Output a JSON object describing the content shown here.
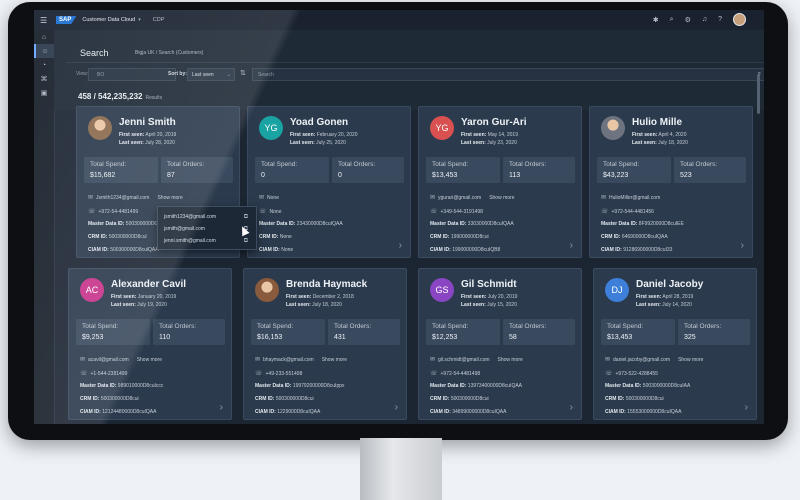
{
  "shell": {
    "logo": "SAP",
    "app_title": "Customer Data Cloud",
    "app_sub": "CDP"
  },
  "header": {
    "title": "Search",
    "breadcrumb": "Bigja UK / Search (Customers)",
    "view_label": "View:",
    "view_value": "BO",
    "sort_label": "Sort by:",
    "sort_value": "Last seen",
    "search_placeholder": "Search",
    "count": "458 / 542,235,232",
    "results_label": "Results"
  },
  "cards": [
    {
      "name": "Jenni Smith",
      "initials": "",
      "color": "#8a6a4d",
      "photo": true,
      "first_seen": "April 20, 2019",
      "last_seen": "July 28, 2020",
      "spend": "$15,682",
      "orders": "87",
      "email": "Jsmith1234@gmail.com",
      "show_more": "Show more",
      "phone": "+972-54-4481499",
      "master": "500300000DGcuiQAA",
      "crm": "500300000D8cul",
      "ciam": "500300000D8culQAA"
    },
    {
      "name": "Yoad Gonen",
      "initials": "YG",
      "color": "#1aa3a3",
      "photo": false,
      "first_seen": "February 20, 2020",
      "last_seen": "July 25, 2020",
      "spend": "0",
      "orders": "0",
      "email": "None",
      "show_more": "",
      "phone": "None",
      "master": "23430000D8cuIQAA",
      "crm": "None",
      "ciam": "None"
    },
    {
      "name": "Yaron Gur-Ari",
      "initials": "YG",
      "color": "#d85050",
      "photo": false,
      "first_seen": "May 14, 2019",
      "last_seen": "July 23, 2020",
      "spend": "$13,453",
      "orders": "113",
      "email": "ygurari@gmail.com",
      "show_more": "Show more",
      "phone": "+349-544-3191498",
      "master": "33030000D8cuIQAA",
      "crm": "199000000D8cui",
      "ciam": "199000000D8cuIQB8"
    },
    {
      "name": "Hulio Mille",
      "initials": "",
      "color": "#6d7480",
      "photo": true,
      "first_seen": "April 4, 2020",
      "last_seen": "July 18, 2020",
      "spend": "$43,223",
      "orders": "523",
      "email": "HulioMiller@gmail.com",
      "show_more": "",
      "phone": "+972-544-4481456",
      "master": "8F9920000D8cuIEE",
      "crm": "64690000D8cuIQAA",
      "ciam": "91286900000D8cuI33"
    },
    {
      "name": "Alexander Cavil",
      "initials": "AC",
      "color": "#c8348c",
      "photo": false,
      "first_seen": "January 20, 2019",
      "last_seen": "July 19, 2020",
      "spend": "$9,253",
      "orders": "110",
      "email": "acavil@gmail.com",
      "show_more": "Show more",
      "phone": "+1-544-2381499",
      "master": "989010000D8cuIccc",
      "crm": "500300000D8cui",
      "ciam": "12124480000D8cuIQAA"
    },
    {
      "name": "Brenda Haymack",
      "initials": "",
      "color": "#8a5a3c",
      "photo": true,
      "first_seen": "December 2, 2018",
      "last_seen": "July 18, 2020",
      "spend": "$16,153",
      "orders": "431",
      "email": "bhaymack@gmail.com",
      "show_more": "Show more",
      "phone": "+49-233-551498",
      "master": "19979200000D8cuIppx",
      "crm": "500300000D8cui",
      "ciam": "1229000D8cuIQAA"
    },
    {
      "name": "Gil Schmidt",
      "initials": "GS",
      "color": "#8a46c2",
      "photo": false,
      "first_seen": "July 20, 2019",
      "last_seen": "July 15, 2020",
      "spend": "$12,253",
      "orders": "58",
      "email": "gil.schmidt@gmail.com",
      "show_more": "Show more",
      "phone": "+972-54-4481498",
      "master": "13973400000D8cuIQAA",
      "crm": "500300000D8cui",
      "ciam": "34899000000D8cuIQAA"
    },
    {
      "name": "Daniel Jacoby",
      "initials": "DJ",
      "color": "#3d7fd9",
      "photo": false,
      "first_seen": "April 28, 2019",
      "last_seen": "July 14, 2020",
      "spend": "$13,453",
      "orders": "325",
      "email": "daniel.jacoby@gmail.com",
      "show_more": "Show more",
      "phone": "+973-522-4288455",
      "master": "5003000000D8cuIAA",
      "crm": "500300000D8cui",
      "ciam": "15553000000D8cuIQAA"
    }
  ],
  "labels": {
    "first_seen": "First seen:",
    "last_seen": "Last seen:",
    "total_spend": "Total Spend:",
    "total_orders": "Total Orders:",
    "master": "Master Data ID:",
    "crm": "CRM ID:",
    "ciam": "CIAM ID:"
  },
  "popover": {
    "items": [
      "jsmith1234@gmail.com",
      "jsmith@gmail.com",
      "jenni.smith@gmail.com"
    ]
  },
  "icons": {
    "menu": "menu-icon",
    "email": "envelope-icon",
    "phone": "phone-icon",
    "copy": "copy-icon",
    "chevron": "chevron-right-icon"
  }
}
